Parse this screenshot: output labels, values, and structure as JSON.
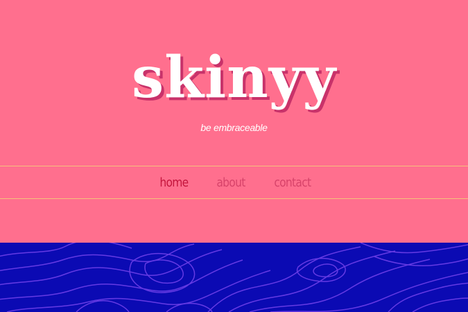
{
  "brand": {
    "logo_text": "skinyy",
    "tagline": "be embraceable"
  },
  "nav": {
    "items": [
      {
        "label": "home",
        "active": true
      },
      {
        "label": "about",
        "active": false
      },
      {
        "label": "contact",
        "active": false
      }
    ]
  },
  "colors": {
    "background_pink": "#ff6f8e",
    "nav_line": "#f4c27a",
    "nav_active": "#c4163d",
    "nav_inactive": "#d7436a",
    "footer_blue": "#0b0ab3",
    "footer_contour": "#6a3de6"
  }
}
